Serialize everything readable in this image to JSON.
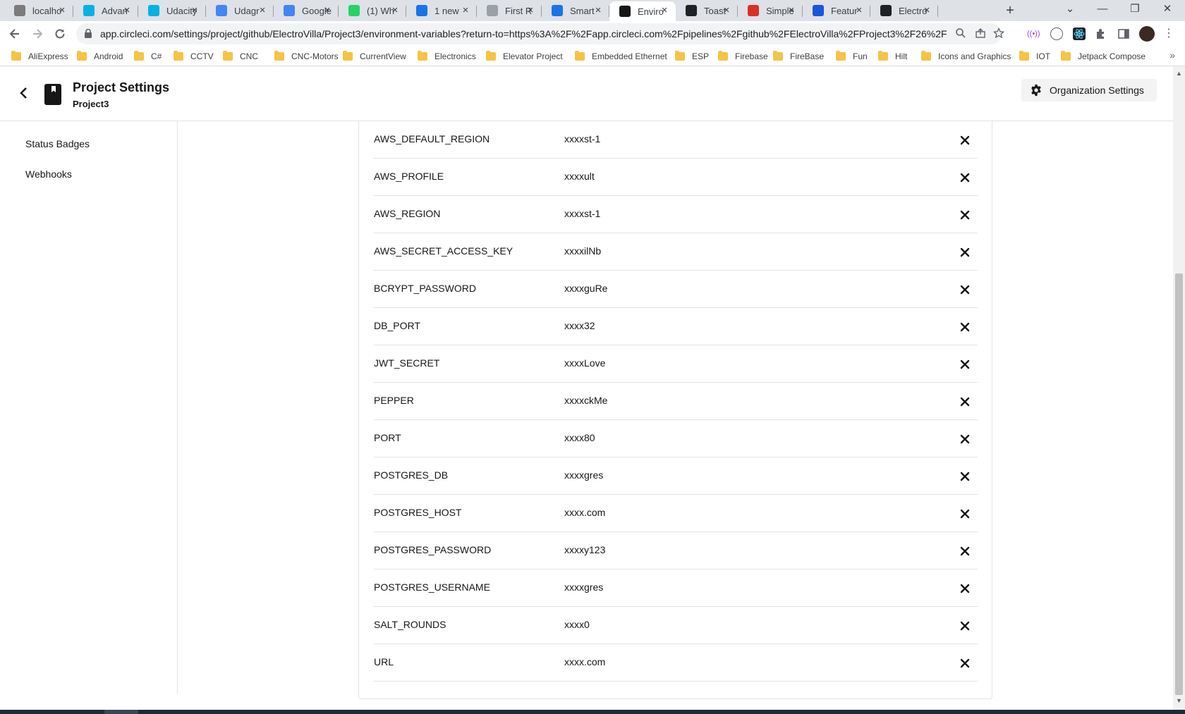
{
  "browser": {
    "tabs": [
      {
        "title": "localho",
        "favicon": "arch-logo-icon",
        "favicon_color": "#7c7c7c"
      },
      {
        "title": "Advan",
        "favicon": "udacity-icon",
        "favicon_color": "#02b3e4"
      },
      {
        "title": "Udacity",
        "favicon": "udacity-icon",
        "favicon_color": "#02b3e4"
      },
      {
        "title": "Udagr",
        "favicon": "chrome-web-icon",
        "favicon_color": "#4285f4"
      },
      {
        "title": "Google",
        "favicon": "google-translate-icon",
        "favicon_color": "#4285f4"
      },
      {
        "title": "(1) Wh",
        "favicon": "whatsapp-icon",
        "favicon_color": "#25d366"
      },
      {
        "title": "1 new",
        "favicon": "circleci-icon",
        "favicon_color": "#1a73e8"
      },
      {
        "title": "First R",
        "favicon": "doc-icon",
        "favicon_color": "#9aa0a6"
      },
      {
        "title": "Smart",
        "favicon": "circleci-icon",
        "favicon_color": "#1a73e8"
      },
      {
        "title": "Enviro",
        "favicon": "circleci-icon",
        "favicon_color": "#161616",
        "active": true
      },
      {
        "title": "Toast",
        "favicon": "toast-icon",
        "favicon_color": "#202124"
      },
      {
        "title": "Simple",
        "favicon": "wcf-icon",
        "favicon_color": "#d93025"
      },
      {
        "title": "Featur",
        "favicon": "feature-icon",
        "favicon_color": "#1a56db"
      },
      {
        "title": "Electro",
        "favicon": "github-icon",
        "favicon_color": "#202124"
      }
    ],
    "new_tab": "+",
    "window_controls": {
      "tab_search": "⌄",
      "minimize": "—",
      "restore": "❐",
      "close": "✕"
    },
    "url": "app.circleci.com/settings/project/github/ElectroVilla/Project3/environment-variables?return-to=https%3A%2F%2Fapp.circleci.com%2Fpipelines%2Fgithub%2FElectroVilla%2FProject3%2F26%2F...",
    "bookmarks": [
      {
        "label": "AliExpress"
      },
      {
        "label": "Android"
      },
      {
        "label": "C#"
      },
      {
        "label": "CCTV"
      },
      {
        "label": "CNC"
      },
      {
        "label": "CNC-Motors"
      },
      {
        "label": "CurrentView"
      },
      {
        "label": "Electronics"
      },
      {
        "label": "Elevator Project"
      },
      {
        "label": "Embedded Ethernet"
      },
      {
        "label": "ESP"
      },
      {
        "label": "Firebase"
      },
      {
        "label": "FireBase"
      },
      {
        "label": "Fun"
      },
      {
        "label": "Hilt"
      },
      {
        "label": "Icons and Graphics"
      },
      {
        "label": "IOT"
      },
      {
        "label": "Jetpack Compose"
      }
    ],
    "bookmarks_more": "»"
  },
  "header": {
    "title": "Project Settings",
    "subtitle": "Project3",
    "org_settings_label": "Organization Settings"
  },
  "sidebar": {
    "items": [
      {
        "label": "Status Badges"
      },
      {
        "label": "Webhooks"
      }
    ]
  },
  "env_vars": [
    {
      "name": "AWS_DEFAULT_REGION",
      "value": "xxxxst-1"
    },
    {
      "name": "AWS_PROFILE",
      "value": "xxxxult"
    },
    {
      "name": "AWS_REGION",
      "value": "xxxxst-1"
    },
    {
      "name": "AWS_SECRET_ACCESS_KEY",
      "value": "xxxxilNb"
    },
    {
      "name": "BCRYPT_PASSWORD",
      "value": "xxxxguRe"
    },
    {
      "name": "DB_PORT",
      "value": "xxxx32"
    },
    {
      "name": "JWT_SECRET",
      "value": "xxxxLove"
    },
    {
      "name": "PEPPER",
      "value": "xxxxckMe"
    },
    {
      "name": "PORT",
      "value": "xxxx80"
    },
    {
      "name": "POSTGRES_DB",
      "value": "xxxxgres"
    },
    {
      "name": "POSTGRES_HOST",
      "value": "xxxx.com"
    },
    {
      "name": "POSTGRES_PASSWORD",
      "value": "xxxxy123"
    },
    {
      "name": "POSTGRES_USERNAME",
      "value": "xxxxgres"
    },
    {
      "name": "SALT_ROUNDS",
      "value": "xxxx0"
    },
    {
      "name": "URL",
      "value": "xxxx.com"
    }
  ],
  "colors": {
    "text_primary": "#161616",
    "border": "#e3e3e3",
    "button_bg": "#f3f3f3",
    "tab_strip": "#dee1e6"
  }
}
